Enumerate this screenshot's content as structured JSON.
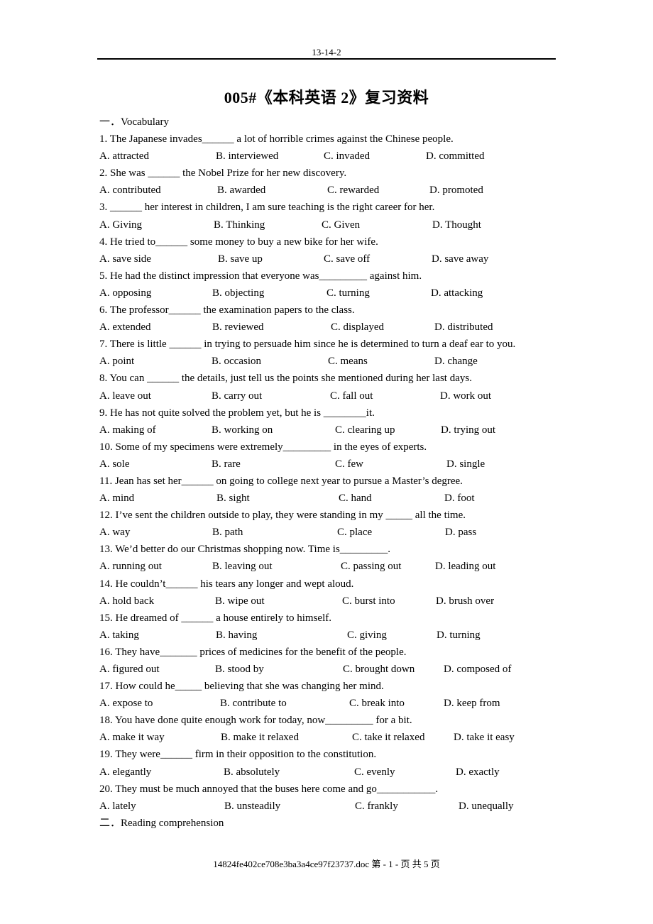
{
  "header": {
    "code": "13-14-2"
  },
  "title": "005#《本科英语 2》复习资料",
  "sections": {
    "vocabulary": "一．Vocabulary",
    "reading": "二．Reading comprehension"
  },
  "questions": [
    {
      "stem": "1.    The Japanese invades______ a lot of horrible crimes against the Chinese people.",
      "options": [
        "A. attracted",
        "B. interviewed",
        "C. invaded",
        "D. committed"
      ]
    },
    {
      "stem": "2. She was ______ the Nobel Prize for her new discovery.",
      "options": [
        "A. contributed",
        "B. awarded",
        "C. rewarded",
        "D. promoted"
      ]
    },
    {
      "stem": "3. ______ her interest in children, I am sure teaching is the right career for her.",
      "options": [
        "A. Giving",
        "B. Thinking",
        "C. Given",
        "D. Thought"
      ]
    },
    {
      "stem": "4. He tried to______ some money to buy a new bike for her wife.",
      "options": [
        "A. save side",
        "B. save up",
        "C. save off",
        "D. save away"
      ]
    },
    {
      "stem": "5. He had the distinct impression that everyone was_________ against him.",
      "options": [
        "A. opposing",
        "B. objecting",
        "C. turning",
        "D. attacking"
      ]
    },
    {
      "stem": "6. The professor______ the examination papers to the class.",
      "options": [
        "A. extended",
        "B. reviewed",
        "C. displayed",
        "D. distributed"
      ]
    },
    {
      "stem": "7. There is little ______ in trying to persuade him since he is determined to turn a deaf ear to you.",
      "options": [
        "A. point",
        "B. occasion",
        "C. means",
        "D. change"
      ]
    },
    {
      "stem": "8. You can ______ the details, just tell us the points she mentioned during her last days.",
      "options": [
        "A. leave out",
        "B. carry out",
        "C. fall out",
        "D. work out"
      ]
    },
    {
      "stem": "9. He has not quite solved the problem yet, but he is ________it.",
      "options": [
        "A. making of",
        "B. working on",
        "C. clearing up",
        "D. trying out"
      ]
    },
    {
      "stem": "10. Some of my specimens were extremely_________ in the eyes of experts.",
      "options": [
        "A. sole",
        "B. rare",
        "C. few",
        "D. single"
      ]
    },
    {
      "stem": "11. Jean has set her______ on going to college next year to pursue a Master’s degree.",
      "options": [
        "A. mind",
        "B. sight",
        "C. hand",
        "D. foot"
      ]
    },
    {
      "stem": "12. I’ve sent the children outside to play, they were standing in my _____ all the time.",
      "options": [
        "A. way",
        "B. path",
        "C. place",
        "D. pass"
      ]
    },
    {
      "stem": "13. We’d better do our Christmas shopping now. Time is_________.",
      "options": [
        "A. running out",
        "B. leaving out",
        "C. passing out",
        "D. leading out"
      ]
    },
    {
      "stem": "14. He couldn’t______ his tears any longer and wept aloud.",
      "options": [
        "A. hold back",
        "B. wipe out",
        "C. burst into",
        "D. brush over"
      ]
    },
    {
      "stem": "15. He dreamed of ______ a house entirely to himself.",
      "options": [
        "A. taking",
        "B. having",
        "C. giving",
        "D. turning"
      ]
    },
    {
      "stem": "16. They have_______ prices of medicines for the benefit of the people.",
      "options": [
        "A. figured out",
        "B. stood by",
        "C. brought down",
        "D. composed of"
      ]
    },
    {
      "stem": "17. How could he_____ believing that she was changing her mind.",
      "options": [
        "A. expose to",
        "B. contribute to",
        "C. break into",
        "D. keep from"
      ]
    },
    {
      "stem": "18. You have done quite enough work for today, now_________ for a bit.",
      "options": [
        "A. make it way",
        "B. make it relaxed",
        "C. take it relaxed",
        "D. take it easy"
      ]
    },
    {
      "stem": "19. They were______ firm in their opposition to the constitution.",
      "options": [
        "A. elegantly",
        "B. absolutely",
        "C. evenly",
        "D. exactly"
      ]
    },
    {
      "stem": "20. They must be much annoyed that the buses here come and go___________.",
      "options": [
        "A. lately",
        "B. unsteadily",
        "C. frankly",
        "D. unequally"
      ]
    }
  ],
  "footer": {
    "text": "14824fe402ce708e3ba3a4ce97f23737.doc 第  - 1 -  页  共  5  页"
  }
}
